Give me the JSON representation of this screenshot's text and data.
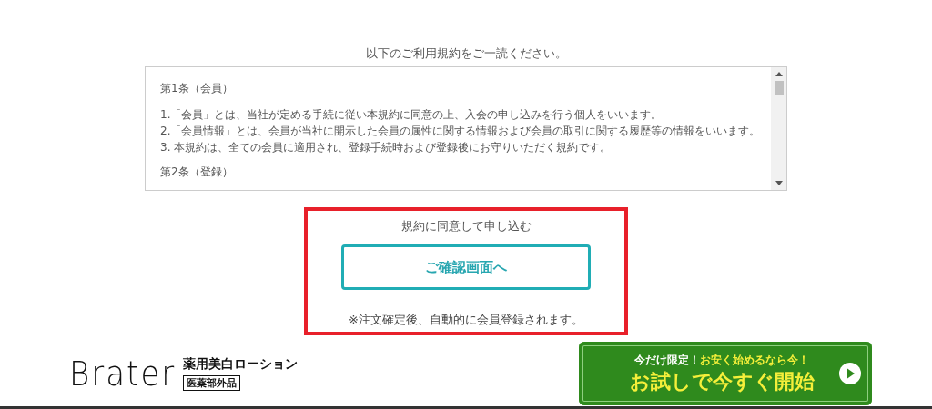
{
  "intro": "以下のご利用規約をご一読ください。",
  "terms": {
    "lines": [
      {
        "kind": "heading",
        "text": "第1条（会員）"
      },
      {
        "kind": "item",
        "text": "1.「会員」とは、当社が定める手続に従い本規約に同意の上、入会の申し込みを行う個人をいいます。"
      },
      {
        "kind": "item",
        "text": "2.「会員情報」とは、会員が当社に開示した会員の属性に関する情報および会員の取引に関する履歴等の情報をいいます。"
      },
      {
        "kind": "item",
        "text": "3. 本規約は、全ての会員に適用され、登録手続時および登録後にお守りいただく規約です。"
      },
      {
        "kind": "heading",
        "text": "第2条（登録）"
      }
    ]
  },
  "agree": {
    "label": "規約に同意して申し込む",
    "button": "ご確認画面へ",
    "note": "※注文確定後、自動的に会員登録されます。"
  },
  "footer": {
    "brand": "Brater",
    "product": "薬用美白ローション",
    "badge": "医薬部外品",
    "banner": {
      "lead": "今だけ限定！",
      "lead_highlight": "お安く始めるなら今！",
      "cta": "お試しで今すぐ開始"
    }
  }
}
